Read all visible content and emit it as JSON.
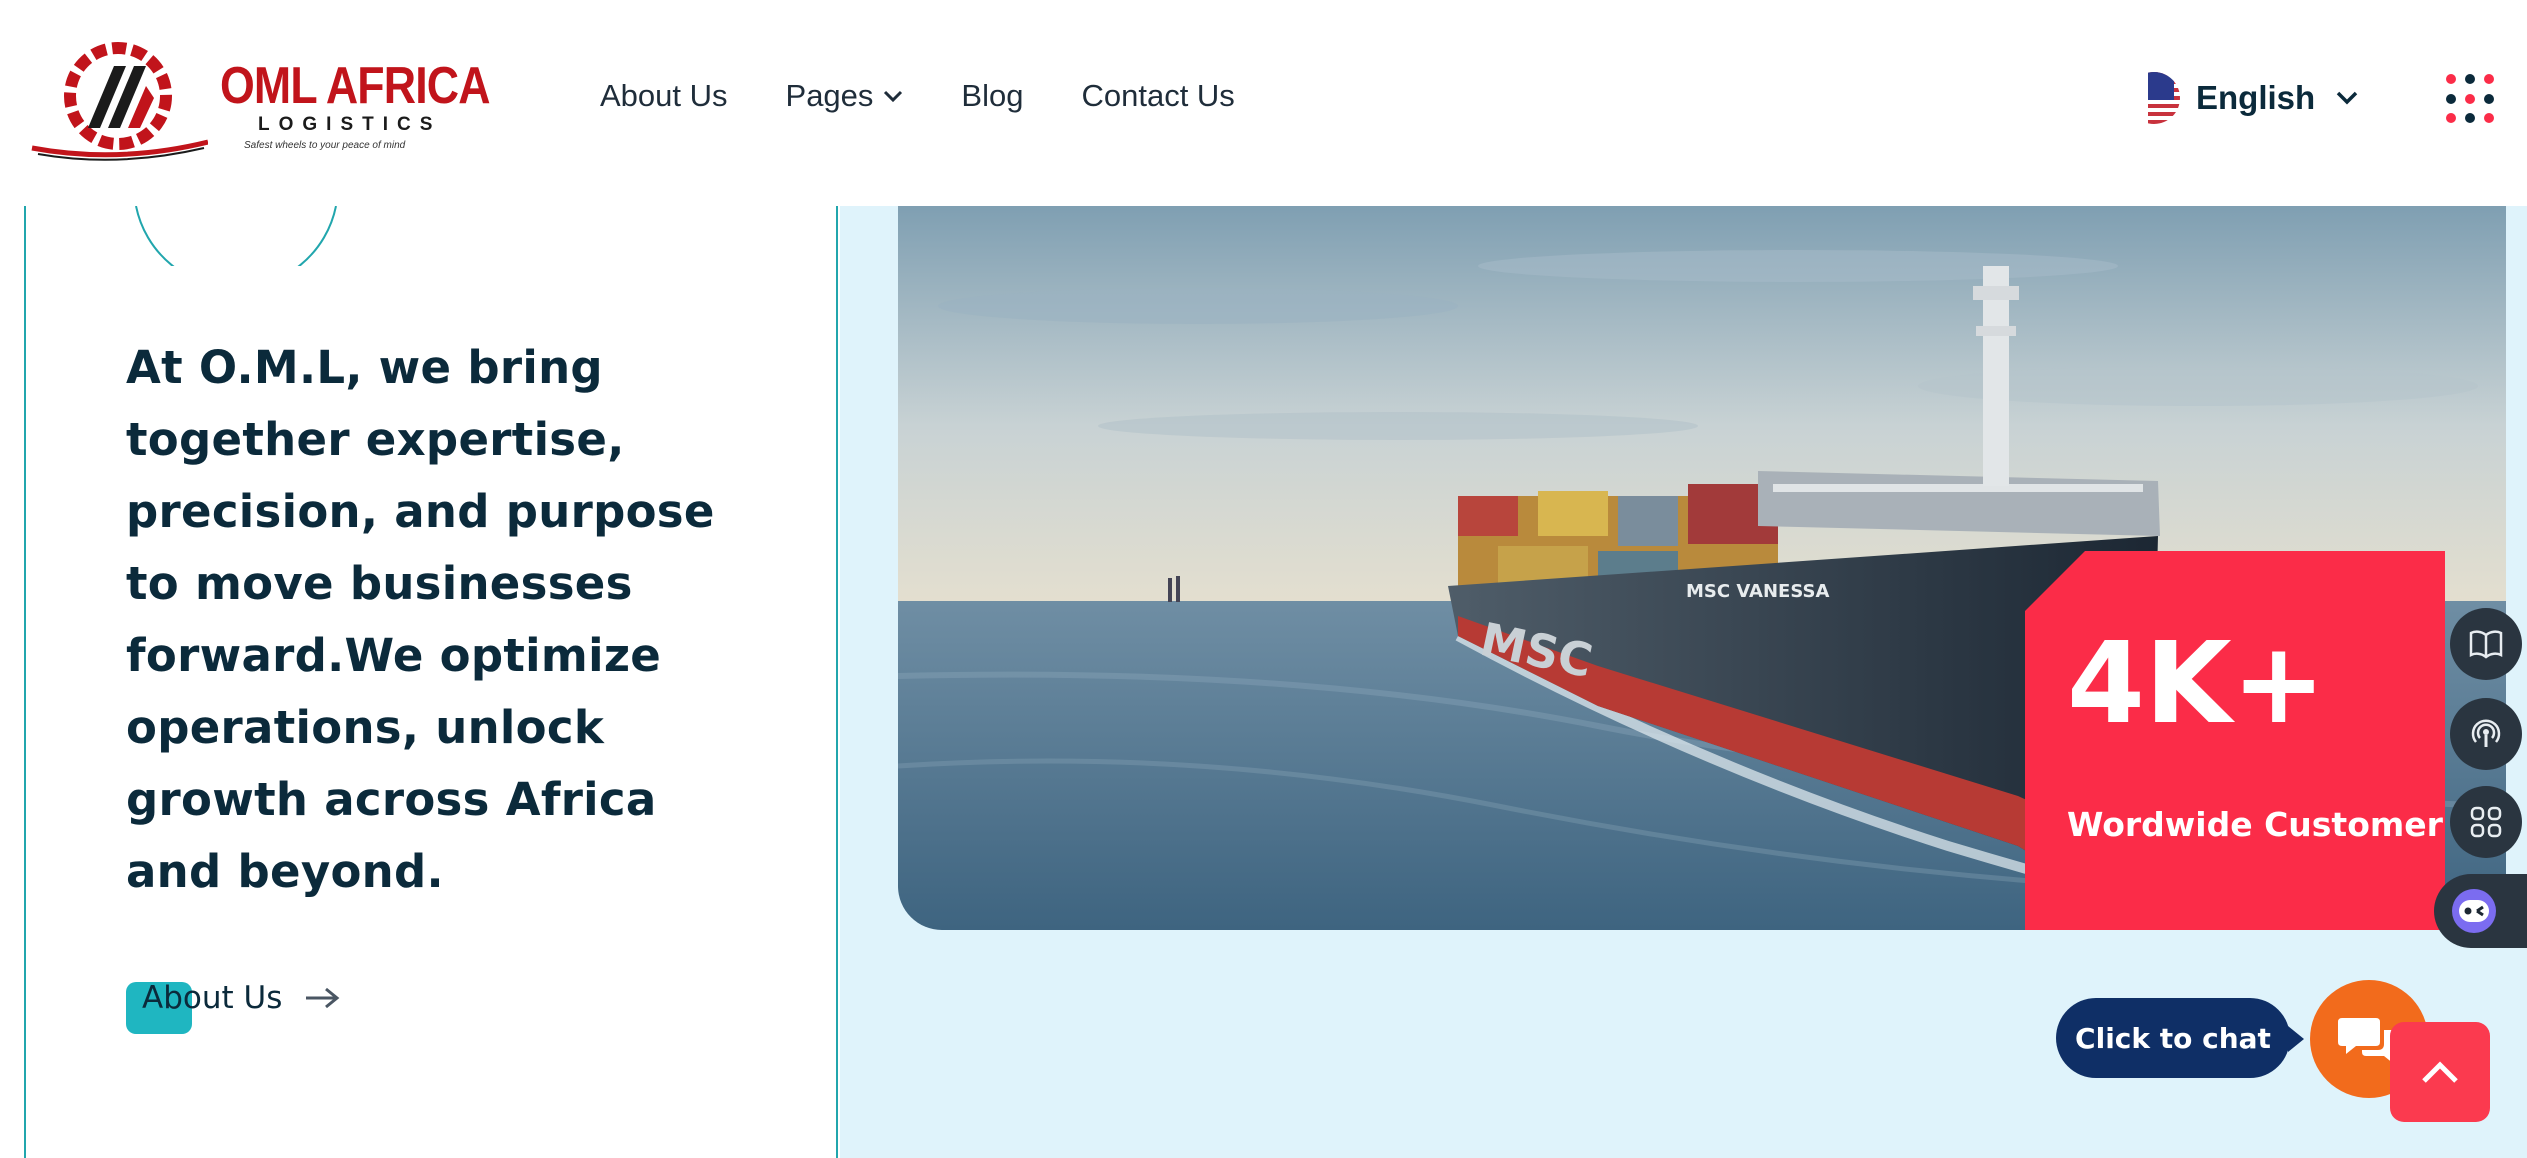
{
  "brand": {
    "name": "OML AFRICA",
    "subtitle": "LOGISTICS",
    "tagline": "Safest wheels to your peace of mind"
  },
  "nav": {
    "items": [
      {
        "label": "About Us"
      },
      {
        "label": "Pages",
        "has_dropdown": true
      },
      {
        "label": "Blog"
      },
      {
        "label": "Contact Us"
      }
    ]
  },
  "language": {
    "label": "English",
    "flag_icon": "us-flag-icon"
  },
  "hero": {
    "headline": "At O.M.L, we bring together expertise, precision, and purpose to move businesses forward.We optimize operations, unlock growth across Africa and beyond.",
    "cta_label": "About Us"
  },
  "image": {
    "ship_name": "MSC VANESSA",
    "hull_text": "MSC"
  },
  "stat": {
    "value": "4K+",
    "label": "Wordwide Customer"
  },
  "side_tools": [
    {
      "icon": "book-icon"
    },
    {
      "icon": "broadcast-icon"
    },
    {
      "icon": "apps-grid-icon"
    },
    {
      "icon": "bot-face-icon"
    }
  ],
  "chat": {
    "label": "Click to chat",
    "icon": "chat-bubbles-icon"
  },
  "colors": {
    "brand_red": "#c1141b",
    "accent_teal": "#21a6ad",
    "stat_red": "#fb2c48",
    "chat_orange": "#f26b1c",
    "chat_navy": "#0f2f66",
    "page_bg": "#dff3fb"
  }
}
